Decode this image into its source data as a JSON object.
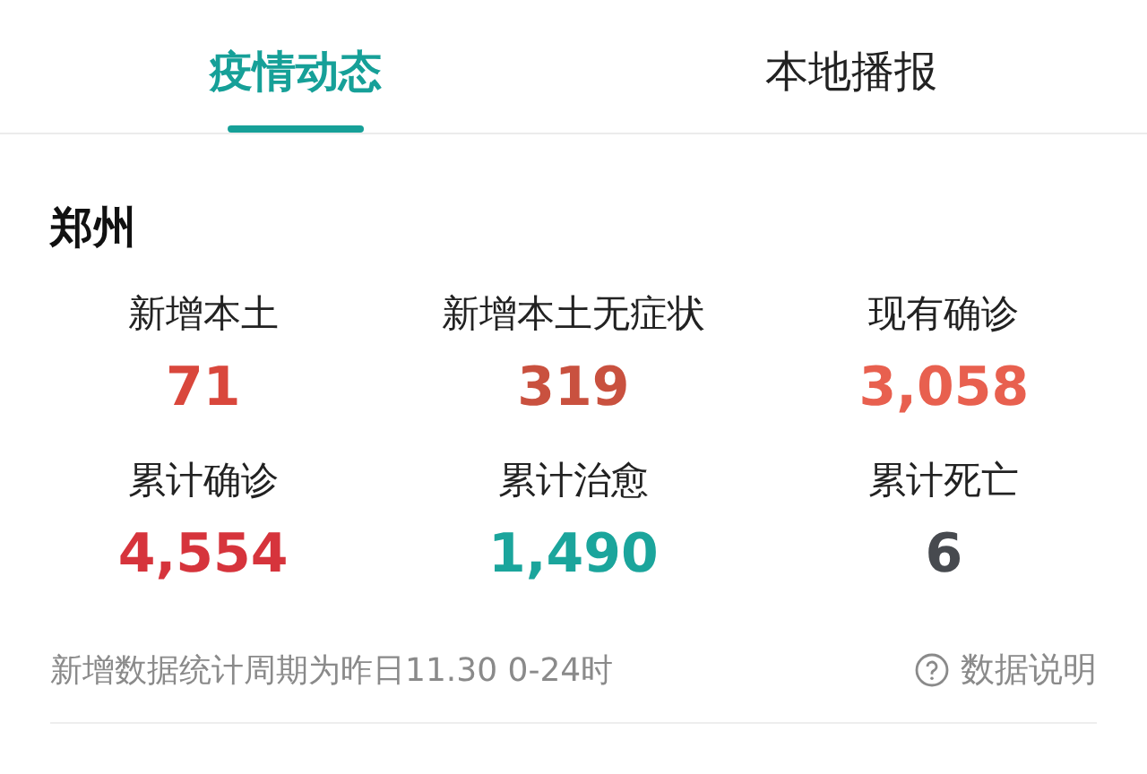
{
  "tabs": [
    {
      "label": "疫情动态",
      "selected": true
    },
    {
      "label": "本地播报",
      "selected": false
    }
  ],
  "city": "郑州",
  "stats": [
    {
      "label": "新增本土",
      "value": "71",
      "color": "#d9473c"
    },
    {
      "label": "新增本土无症状",
      "value": "319",
      "color": "#c9513f"
    },
    {
      "label": "现有确诊",
      "value": "3,058",
      "color": "#e8604f"
    },
    {
      "label": "累计确诊",
      "value": "4,554",
      "color": "#d6343c"
    },
    {
      "label": "累计治愈",
      "value": "1,490",
      "color": "#1ba59c"
    },
    {
      "label": "累计死亡",
      "value": "6",
      "color": "#474a4f"
    }
  ],
  "footer": {
    "note": "新增数据统计周期为昨日11.30 0-24时",
    "help": "数据说明"
  }
}
